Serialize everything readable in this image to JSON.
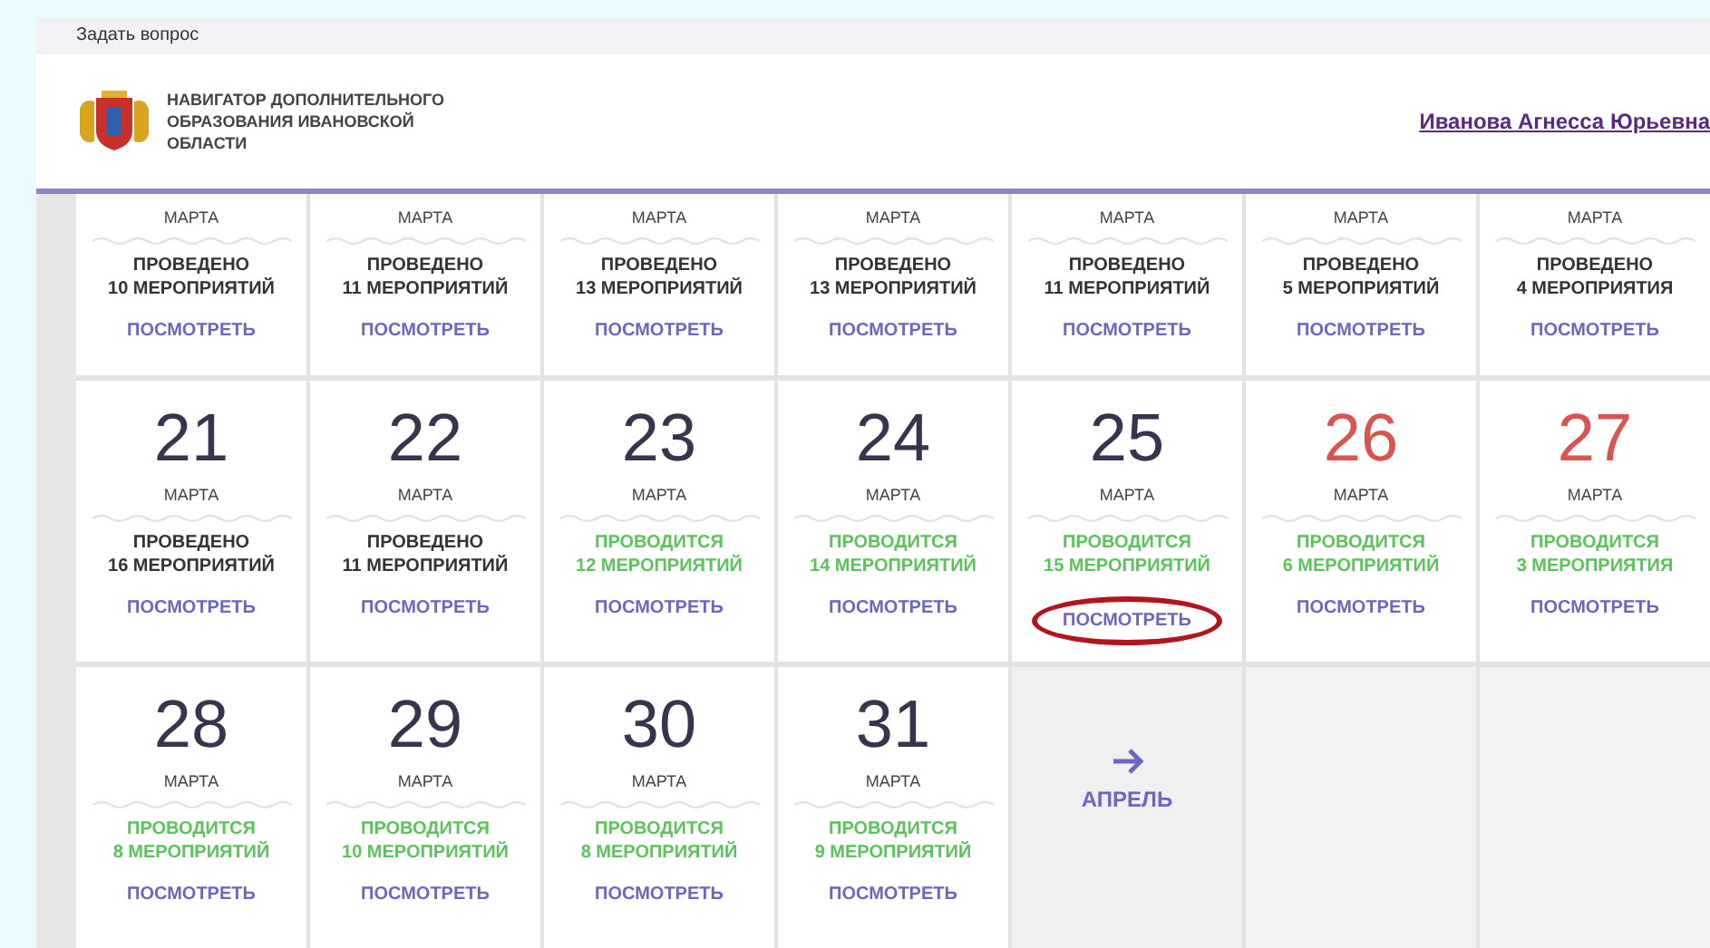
{
  "topbar": {
    "link": "Задать вопрос"
  },
  "header": {
    "site_title": "НАВИГАТОР ДОПОЛНИТЕЛЬНОГО ОБРАЗОВАНИЯ ИВАНОВСКОЙ ОБЛАСТИ",
    "user": "Иванова Агнесса Юрьевна"
  },
  "weeks": [
    {
      "cells": [
        {
          "kind": "day",
          "month": "МАРТА",
          "ongoing": false,
          "status": "ПРОВЕДЕНО",
          "count": "10 МЕРОПРИЯТИЙ",
          "link": "ПОСМОТРЕТЬ",
          "circled": false
        },
        {
          "kind": "day",
          "month": "МАРТА",
          "ongoing": false,
          "status": "ПРОВЕДЕНО",
          "count": "11 МЕРОПРИЯТИЙ",
          "link": "ПОСМОТРЕТЬ",
          "circled": false
        },
        {
          "kind": "day",
          "month": "МАРТА",
          "ongoing": false,
          "status": "ПРОВЕДЕНО",
          "count": "13 МЕРОПРИЯТИЙ",
          "link": "ПОСМОТРЕТЬ",
          "circled": false
        },
        {
          "kind": "day",
          "month": "МАРТА",
          "ongoing": false,
          "status": "ПРОВЕДЕНО",
          "count": "13 МЕРОПРИЯТИЙ",
          "link": "ПОСМОТРЕТЬ",
          "circled": false
        },
        {
          "kind": "day",
          "month": "МАРТА",
          "ongoing": false,
          "status": "ПРОВЕДЕНО",
          "count": "11 МЕРОПРИЯТИЙ",
          "link": "ПОСМОТРЕТЬ",
          "circled": false
        },
        {
          "kind": "day",
          "month": "МАРТА",
          "ongoing": false,
          "status": "ПРОВЕДЕНО",
          "count": "5 МЕРОПРИЯТИЙ",
          "link": "ПОСМОТРЕТЬ",
          "circled": false
        },
        {
          "kind": "day",
          "month": "МАРТА",
          "ongoing": false,
          "status": "ПРОВЕДЕНО",
          "count": "4 МЕРОПРИЯТИЯ",
          "link": "ПОСМОТРЕТЬ",
          "circled": false
        }
      ]
    },
    {
      "cells": [
        {
          "kind": "day",
          "day": "21",
          "weekend": false,
          "month": "МАРТА",
          "ongoing": false,
          "status": "ПРОВЕДЕНО",
          "count": "16 МЕРОПРИЯТИЙ",
          "link": "ПОСМОТРЕТЬ",
          "circled": false
        },
        {
          "kind": "day",
          "day": "22",
          "weekend": false,
          "month": "МАРТА",
          "ongoing": false,
          "status": "ПРОВЕДЕНО",
          "count": "11 МЕРОПРИЯТИЙ",
          "link": "ПОСМОТРЕТЬ",
          "circled": false
        },
        {
          "kind": "day",
          "day": "23",
          "weekend": false,
          "month": "МАРТА",
          "ongoing": true,
          "status": "ПРОВОДИТСЯ",
          "count": "12 МЕРОПРИЯТИЙ",
          "link": "ПОСМОТРЕТЬ",
          "circled": false
        },
        {
          "kind": "day",
          "day": "24",
          "weekend": false,
          "month": "МАРТА",
          "ongoing": true,
          "status": "ПРОВОДИТСЯ",
          "count": "14 МЕРОПРИЯТИЙ",
          "link": "ПОСМОТРЕТЬ",
          "circled": false
        },
        {
          "kind": "day",
          "day": "25",
          "weekend": false,
          "month": "МАРТА",
          "ongoing": true,
          "status": "ПРОВОДИТСЯ",
          "count": "15 МЕРОПРИЯТИЙ",
          "link": "ПОСМОТРЕТЬ",
          "circled": true
        },
        {
          "kind": "day",
          "day": "26",
          "weekend": true,
          "month": "МАРТА",
          "ongoing": true,
          "status": "ПРОВОДИТСЯ",
          "count": "6 МЕРОПРИЯТИЙ",
          "link": "ПОСМОТРЕТЬ",
          "circled": false
        },
        {
          "kind": "day",
          "day": "27",
          "weekend": true,
          "month": "МАРТА",
          "ongoing": true,
          "status": "ПРОВОДИТСЯ",
          "count": "3 МЕРОПРИЯТИЯ",
          "link": "ПОСМОТРЕТЬ",
          "circled": false
        }
      ]
    },
    {
      "cells": [
        {
          "kind": "day",
          "day": "28",
          "weekend": false,
          "month": "МАРТА",
          "ongoing": true,
          "status": "ПРОВОДИТСЯ",
          "count": "8 МЕРОПРИЯТИЙ",
          "link": "ПОСМОТРЕТЬ",
          "circled": false
        },
        {
          "kind": "day",
          "day": "29",
          "weekend": false,
          "month": "МАРТА",
          "ongoing": true,
          "status": "ПРОВОДИТСЯ",
          "count": "10 МЕРОПРИЯТИЙ",
          "link": "ПОСМОТРЕТЬ",
          "circled": false
        },
        {
          "kind": "day",
          "day": "30",
          "weekend": false,
          "month": "МАРТА",
          "ongoing": true,
          "status": "ПРОВОДИТСЯ",
          "count": "8 МЕРОПРИЯТИЙ",
          "link": "ПОСМОТРЕТЬ",
          "circled": false
        },
        {
          "kind": "day",
          "day": "31",
          "weekend": false,
          "month": "МАРТА",
          "ongoing": true,
          "status": "ПРОВОДИТСЯ",
          "count": "9 МЕРОПРИЯТИЙ",
          "link": "ПОСМОТРЕТЬ",
          "circled": false
        },
        {
          "kind": "next",
          "label": "АПРЕЛЬ"
        },
        {
          "kind": "empty"
        },
        {
          "kind": "empty"
        }
      ]
    }
  ]
}
